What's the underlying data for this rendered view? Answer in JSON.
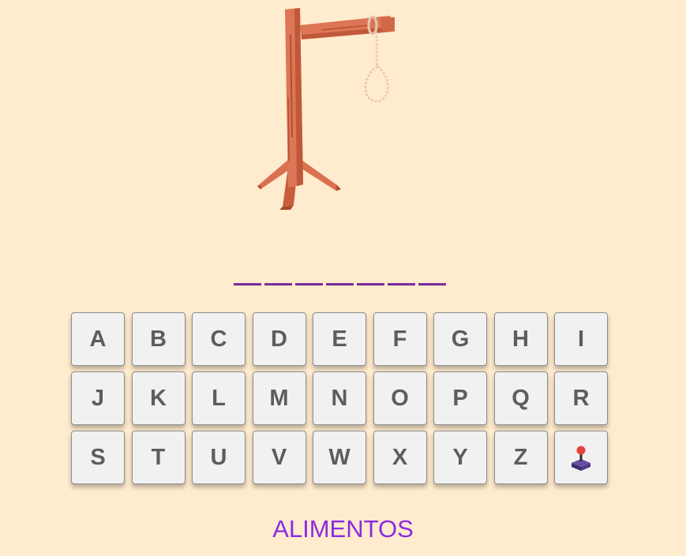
{
  "game": {
    "word_length": 7,
    "category": "ALIMENTOS"
  },
  "keyboard": {
    "keys": [
      "A",
      "B",
      "C",
      "D",
      "E",
      "F",
      "G",
      "H",
      "I",
      "J",
      "K",
      "L",
      "M",
      "N",
      "O",
      "P",
      "Q",
      "R",
      "S",
      "T",
      "U",
      "V",
      "W",
      "X",
      "Y",
      "Z"
    ],
    "extra_key_icon": "joystick-icon"
  },
  "colors": {
    "background": "#ffebcd",
    "slot_line": "#7d2a9c",
    "category_text": "#8a2be2",
    "key_face": "#f1f1f1",
    "key_text": "#5d5d5d"
  },
  "icons": {
    "gallows": "gallows-with-noose-icon"
  }
}
